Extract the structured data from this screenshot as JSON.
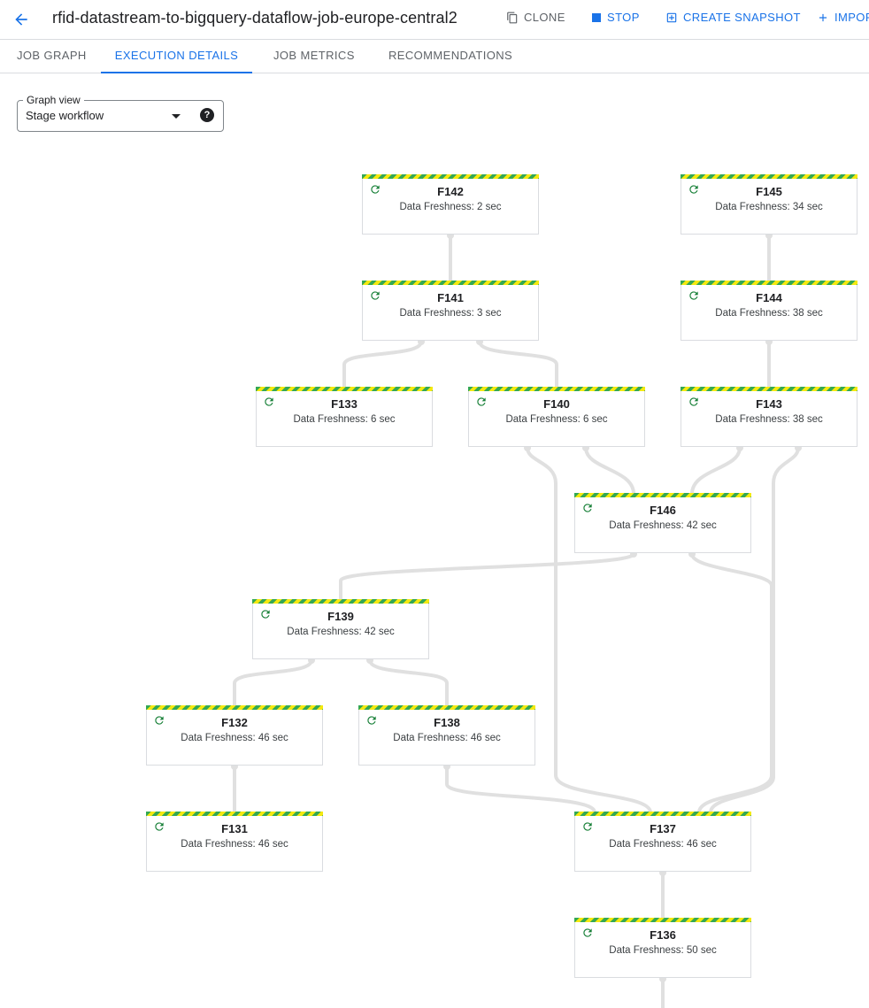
{
  "header": {
    "title": "rfid-datastream-to-bigquery-dataflow-job-europe-central2",
    "actions": {
      "clone": "CLONE",
      "stop": "STOP",
      "create_snapshot": "CREATE SNAPSHOT",
      "import": "IMPOR"
    }
  },
  "tabs": [
    "JOB GRAPH",
    "EXECUTION DETAILS",
    "JOB METRICS",
    "RECOMMENDATIONS"
  ],
  "active_tab": "EXECUTION DETAILS",
  "graph_view": {
    "label": "Graph view",
    "value": "Stage workflow"
  },
  "stages": {
    "F142": {
      "name": "F142",
      "freshness": "Data Freshness: 2 sec"
    },
    "F145": {
      "name": "F145",
      "freshness": "Data Freshness: 34 sec"
    },
    "F141": {
      "name": "F141",
      "freshness": "Data Freshness: 3 sec"
    },
    "F144": {
      "name": "F144",
      "freshness": "Data Freshness: 38 sec"
    },
    "F133": {
      "name": "F133",
      "freshness": "Data Freshness: 6 sec"
    },
    "F140": {
      "name": "F140",
      "freshness": "Data Freshness: 6 sec"
    },
    "F143": {
      "name": "F143",
      "freshness": "Data Freshness: 38 sec"
    },
    "F146": {
      "name": "F146",
      "freshness": "Data Freshness: 42 sec"
    },
    "F139": {
      "name": "F139",
      "freshness": "Data Freshness: 42 sec"
    },
    "F132": {
      "name": "F132",
      "freshness": "Data Freshness: 46 sec"
    },
    "F138": {
      "name": "F138",
      "freshness": "Data Freshness: 46 sec"
    },
    "F131": {
      "name": "F131",
      "freshness": "Data Freshness: 46 sec"
    },
    "F137": {
      "name": "F137",
      "freshness": "Data Freshness: 46 sec"
    },
    "F136": {
      "name": "F136",
      "freshness": "Data Freshness: 50 sec"
    }
  },
  "edges": [
    [
      "F142",
      "F141"
    ],
    [
      "F145",
      "F144"
    ],
    [
      "F144",
      "F143"
    ],
    [
      "F141",
      "F133"
    ],
    [
      "F141",
      "F140"
    ],
    [
      "F140",
      "F146"
    ],
    [
      "F143",
      "F146"
    ],
    [
      "F146",
      "F139"
    ],
    [
      "F139",
      "F132"
    ],
    [
      "F139",
      "F138"
    ],
    [
      "F132",
      "F131"
    ],
    [
      "F138",
      "F137"
    ],
    [
      "F140",
      "F137"
    ],
    [
      "F146",
      "F137"
    ],
    [
      "F143",
      "F137"
    ],
    [
      "F137",
      "F136"
    ]
  ],
  "colors": {
    "accent": "#1a73e8",
    "stripe_green": "#34a853",
    "stripe_yellow": "#f5e90f",
    "edge": "#e0e0e0",
    "running_icon": "#188038"
  },
  "icons": {
    "back": "arrow-left-icon",
    "clone": "copy-icon",
    "stop": "stop-square-icon",
    "snapshot": "snapshot-icon",
    "import": "plus-icon",
    "help": "help-circle-icon",
    "stage_status": "refresh-running-icon"
  }
}
